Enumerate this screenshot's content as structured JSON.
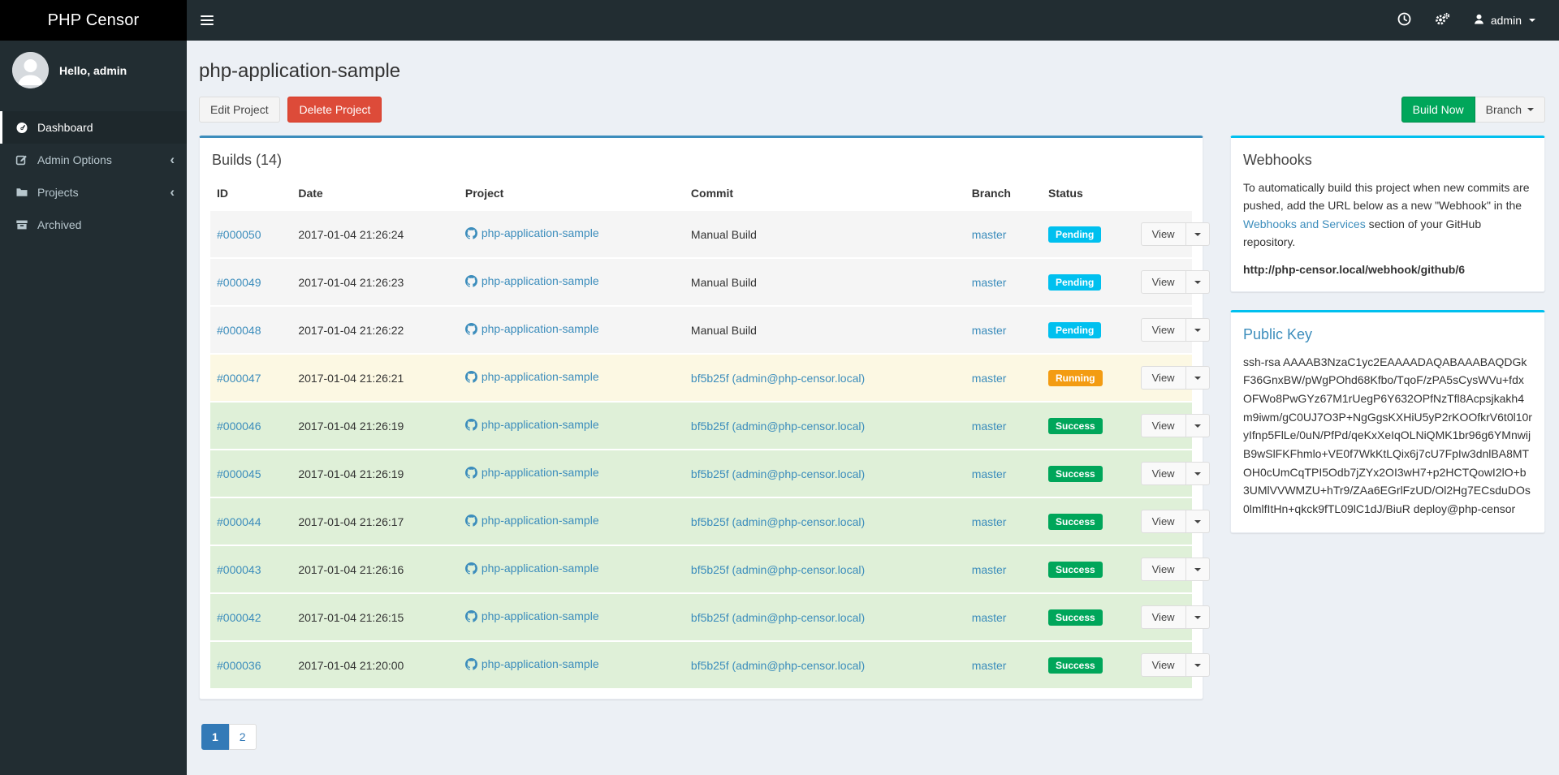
{
  "app": {
    "brand": "PHP Censor"
  },
  "navbar": {
    "user_label": "admin",
    "icons": {
      "history-icon": "clock glyph",
      "settings-icon": "double gears glyph",
      "user-icon": "person silhouette",
      "caret-down-icon": "▾",
      "hamburger-icon": "☰"
    }
  },
  "sidebar": {
    "greeting": "Hello, admin",
    "items": [
      {
        "label": "Dashboard",
        "icon": "dashboard-icon",
        "active": true,
        "chevron": false
      },
      {
        "label": "Admin Options",
        "icon": "edit-icon",
        "active": false,
        "chevron": true
      },
      {
        "label": "Projects",
        "icon": "folder-icon",
        "active": false,
        "chevron": true
      },
      {
        "label": "Archived",
        "icon": "archive-icon",
        "active": false,
        "chevron": false
      }
    ],
    "chevron_glyph": "‹"
  },
  "page": {
    "title": "php-application-sample",
    "edit_button": "Edit Project",
    "delete_button": "Delete Project",
    "build_now_button": "Build Now",
    "branch_button": "Branch"
  },
  "builds": {
    "title": "Builds (14)",
    "columns": [
      "ID",
      "Date",
      "Project",
      "Commit",
      "Branch",
      "Status"
    ],
    "view_label": "View",
    "rows": [
      {
        "id": "#000050",
        "date": "2017-01-04 21:26:24",
        "project": "php-application-sample",
        "commit": "Manual Build",
        "commit_is_link": false,
        "branch": "master",
        "status": "Pending"
      },
      {
        "id": "#000049",
        "date": "2017-01-04 21:26:23",
        "project": "php-application-sample",
        "commit": "Manual Build",
        "commit_is_link": false,
        "branch": "master",
        "status": "Pending"
      },
      {
        "id": "#000048",
        "date": "2017-01-04 21:26:22",
        "project": "php-application-sample",
        "commit": "Manual Build",
        "commit_is_link": false,
        "branch": "master",
        "status": "Pending"
      },
      {
        "id": "#000047",
        "date": "2017-01-04 21:26:21",
        "project": "php-application-sample",
        "commit": "bf5b25f (admin@php-censor.local)",
        "commit_is_link": true,
        "branch": "master",
        "status": "Running"
      },
      {
        "id": "#000046",
        "date": "2017-01-04 21:26:19",
        "project": "php-application-sample",
        "commit": "bf5b25f (admin@php-censor.local)",
        "commit_is_link": true,
        "branch": "master",
        "status": "Success"
      },
      {
        "id": "#000045",
        "date": "2017-01-04 21:26:19",
        "project": "php-application-sample",
        "commit": "bf5b25f (admin@php-censor.local)",
        "commit_is_link": true,
        "branch": "master",
        "status": "Success"
      },
      {
        "id": "#000044",
        "date": "2017-01-04 21:26:17",
        "project": "php-application-sample",
        "commit": "bf5b25f (admin@php-censor.local)",
        "commit_is_link": true,
        "branch": "master",
        "status": "Success"
      },
      {
        "id": "#000043",
        "date": "2017-01-04 21:26:16",
        "project": "php-application-sample",
        "commit": "bf5b25f (admin@php-censor.local)",
        "commit_is_link": true,
        "branch": "master",
        "status": "Success"
      },
      {
        "id": "#000042",
        "date": "2017-01-04 21:26:15",
        "project": "php-application-sample",
        "commit": "bf5b25f (admin@php-censor.local)",
        "commit_is_link": true,
        "branch": "master",
        "status": "Success"
      },
      {
        "id": "#000036",
        "date": "2017-01-04 21:20:00",
        "project": "php-application-sample",
        "commit": "bf5b25f (admin@php-censor.local)",
        "commit_is_link": true,
        "branch": "master",
        "status": "Success"
      }
    ]
  },
  "pagination": {
    "pages": [
      {
        "label": "1",
        "active": true
      },
      {
        "label": "2",
        "active": false
      }
    ]
  },
  "webhooks": {
    "title": "Webhooks",
    "text_before": "To automatically build this project when new commits are pushed, add the URL below as a new \"Webhook\" in the ",
    "link_text": "Webhooks and Services",
    "text_after": " section of your GitHub repository.",
    "url": "http://php-censor.local/webhook/github/6"
  },
  "public_key": {
    "title": "Public Key",
    "key": "ssh-rsa AAAAB3NzaC1yc2EAAAADAQABAAABAQDGkF36GnxBW/pWgPOhd68Kfbo/TqoF/zPA5sCysWVu+fdxOFWo8PwGYz67M1rUegP6Y632OPfNzTfl8Acpsjkakh4m9iwm/gC0UJ7O3P+NgGgsKXHiU5yP2rKOOfkrV6t0l10ryIfnp5FlLe/0uN/PfPd/qeKxXeIqOLNiQMK1br96g6YMnwijB9wSlFKFhmlo+VE0f7WkKtLQix6j7cU7FpIw3dnlBA8MTOH0cUmCqTPI5Odb7jZYx2OI3wH7+p2HCTQowI2lO+b3UMlVVWMZU+hTr9/ZAa6EGrlFzUD/Ol2Hg7ECsduDOs0lmlfItHn+qkck9fTL09lC1dJ/BiuR deploy@php-censor"
  },
  "colors": {
    "accent_blue": "#3c8dbc",
    "aqua": "#00c0ef",
    "pending": "#00c0ef",
    "running": "#f39c12",
    "success": "#00a65a",
    "danger": "#dd4b39",
    "navbar_dark": "#222d32",
    "logo_black": "#000000",
    "content_bg": "#ecf0f5",
    "row_pending_bg": "#f5f5f5",
    "row_running_bg": "#fcf8e3",
    "row_success_bg": "#dff0d8"
  }
}
